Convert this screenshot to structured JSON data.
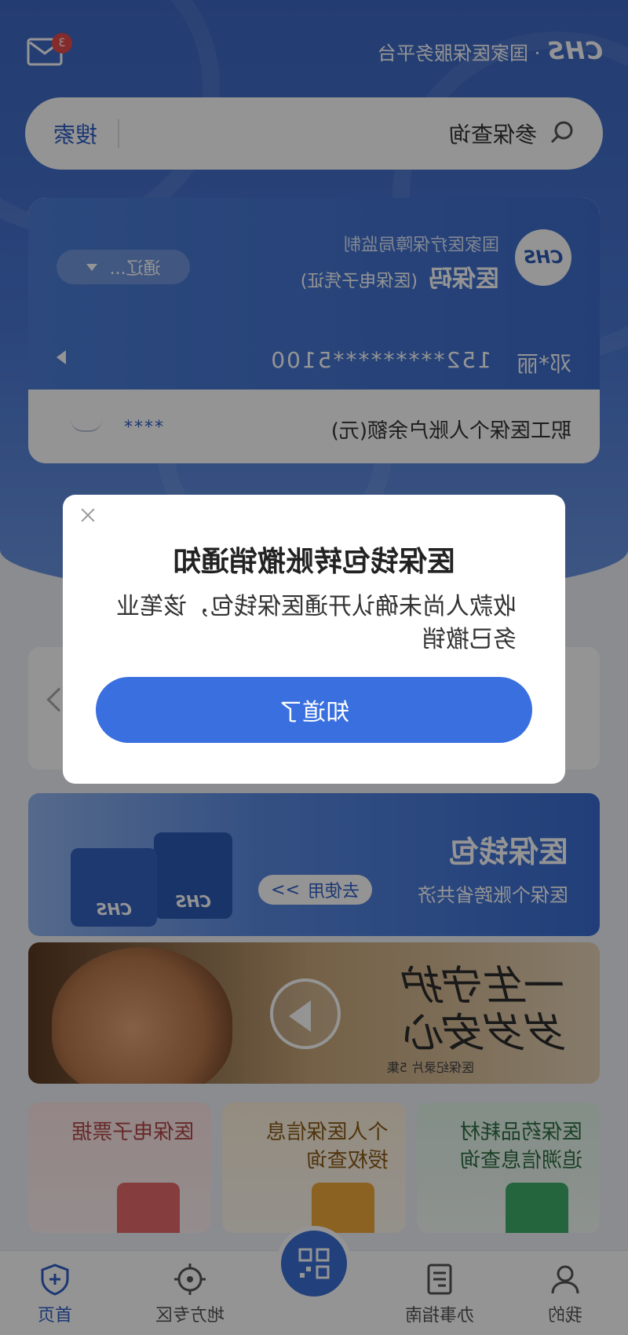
{
  "header": {
    "logo_mark": "CHS",
    "logo_text": "· 国家医保服务平台",
    "message_badge": "3"
  },
  "search": {
    "placeholder": "参保查询",
    "button": "搜索"
  },
  "insurance_card": {
    "logo_mark": "CHS",
    "org": "国家医疗保障局监制",
    "title": "医保码",
    "subtitle": "(医保电子凭证)",
    "region": "通辽...",
    "holder_name": "邓*丽",
    "id_masked": "152*********5100",
    "balance_label": "职工医保个人账户余额(元)",
    "balance_value": "****"
  },
  "wallet": {
    "title": "医保钱包",
    "subtitle": "医保个账跨省共济",
    "button": "去使用",
    "button_arrow": ">>",
    "box_mark": "CHS"
  },
  "banner": {
    "headline": "一生守护 岁岁安心",
    "sub": "医保纪录片 5集"
  },
  "services": [
    {
      "line1": "医保药品耗材",
      "line2": "追溯信息查询"
    },
    {
      "line1": "个人医保信息",
      "line2": "授权查询"
    },
    {
      "line1": "医保电子票据",
      "line2": ""
    }
  ],
  "tabbar": {
    "home": "首页",
    "local": "地方专区",
    "guide": "办事指南",
    "mine": "我的"
  },
  "modal": {
    "title": "医保钱包转账撤销通知",
    "body": "收款人尚未确认开通医保钱包，该笔业务已撤销",
    "button": "知道了"
  },
  "colors": {
    "brand_blue": "#3a6fe0",
    "hero_blue": "#3d68c4",
    "badge_red": "#e54b4b"
  }
}
